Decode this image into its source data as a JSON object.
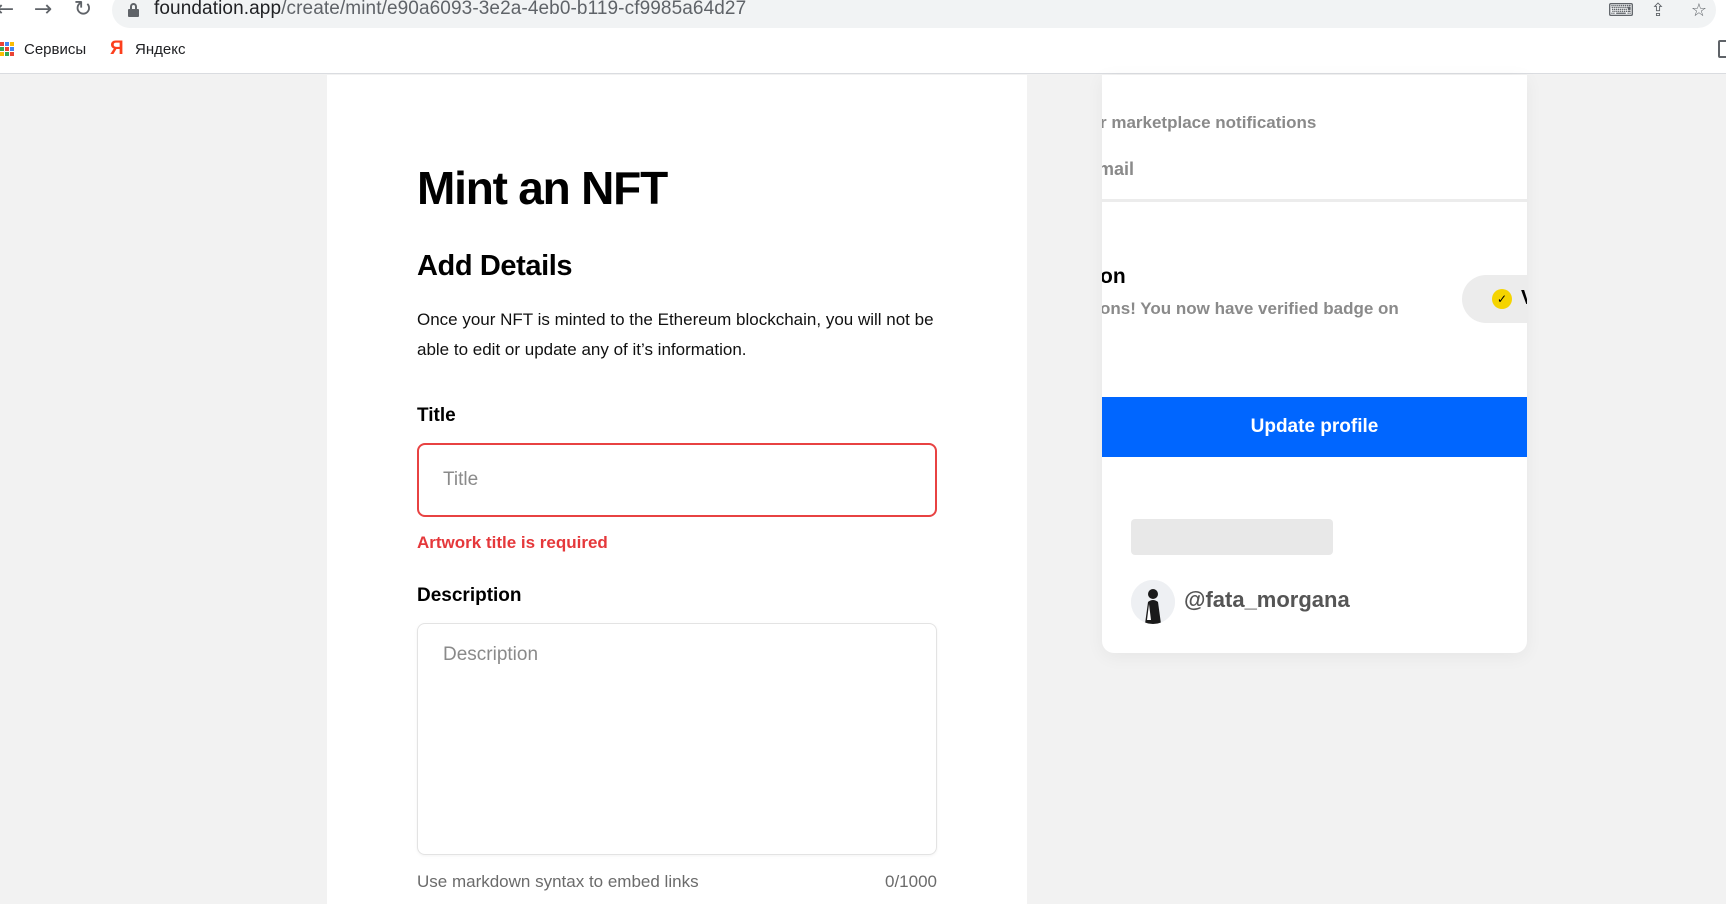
{
  "browser": {
    "url_host": "foundation.app",
    "url_path": "/create/mint/e90a6093-3e2a-4eb0-b119-cf9985a64d27",
    "bookmarks": [
      {
        "label": "Сервисы"
      },
      {
        "label": "Яндекс"
      }
    ]
  },
  "form": {
    "page_title": "Mint an NFT",
    "section_title": "Add Details",
    "section_description": "Once your NFT is minted to the Ethereum blockchain, you will not be able to edit or update any of it’s information.",
    "title_label": "Title",
    "title_placeholder": "Title",
    "title_value": "",
    "title_error": "Artwork title is required",
    "description_label": "Description",
    "description_placeholder": "Description",
    "description_value": "",
    "description_hint": "Use markdown syntax to embed links",
    "description_counter": "0/1000"
  },
  "profile_panel": {
    "notifications_text": "r marketplace notifications",
    "email_text": "mail",
    "verification_heading": "on",
    "verification_text": "ons! You now have verified badge on",
    "verified_chip_text": "V",
    "update_button": "Update profile",
    "username": "@fata_morgana"
  },
  "colors": {
    "primary_blue": "#0066ff",
    "error_red": "#e5383b",
    "verified_yellow": "#f5d400"
  }
}
